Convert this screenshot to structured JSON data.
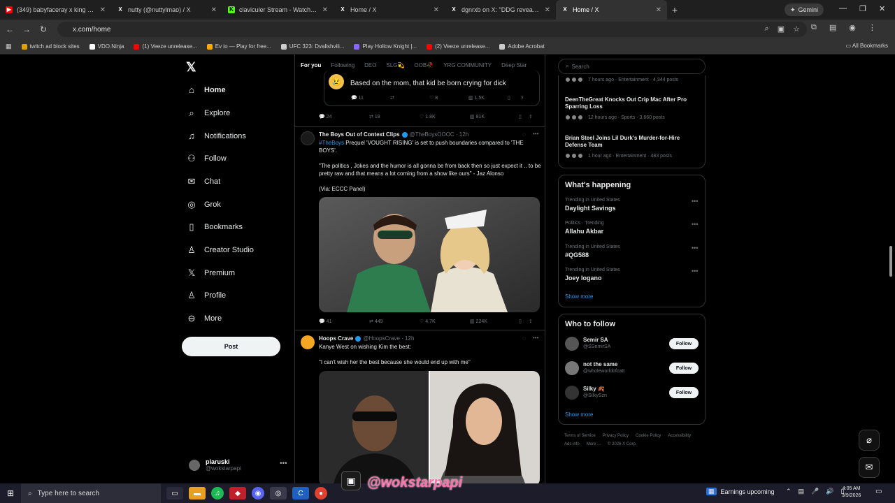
{
  "browser": {
    "tabs": [
      {
        "title": "(349) babyfaceray x king hendr",
        "fav_color": "#ff0000",
        "fav": "▶"
      },
      {
        "title": "nutty (@nuttylmao) / X",
        "fav_color": "#000000",
        "fav": "X"
      },
      {
        "title": "claviculer Stream - Watch Live o",
        "fav_color": "#53fc18",
        "fav": "K"
      },
      {
        "title": "Home / X",
        "fav_color": "#000000",
        "fav": "X"
      },
      {
        "title": "dgnrxb on X: \"DDG revealed th",
        "fav_color": "#000000",
        "fav": "X"
      },
      {
        "title": "Home / X",
        "fav_color": "#000000",
        "fav": "X"
      }
    ],
    "gemini_label": "Gemini",
    "url": "x.com/home",
    "bookmarks": [
      {
        "label": "twitch ad block sites",
        "color": "#e0a000"
      },
      {
        "label": "VDO.Ninja",
        "color": "#ffffff"
      },
      {
        "label": "(1) Veeze unrelease...",
        "color": "#ff0000"
      },
      {
        "label": "Ev io — Play for free...",
        "color": "#ffaa00"
      },
      {
        "label": "UFC 323: Dvalishvili...",
        "color": "#cccccc"
      },
      {
        "label": "Play Hollow Knight |...",
        "color": "#8866ff"
      },
      {
        "label": "(2) Veeze unrelease...",
        "color": "#ff0000"
      },
      {
        "label": "Adobe Acrobat",
        "color": "#cccccc"
      }
    ],
    "all_bookmarks": "All Bookmarks"
  },
  "nav": {
    "items": [
      {
        "label": "Home",
        "icon": "home-icon",
        "glyph": "⌂"
      },
      {
        "label": "Explore",
        "icon": "search-icon",
        "glyph": "⌕"
      },
      {
        "label": "Notifications",
        "icon": "bell-icon",
        "glyph": "🔔"
      },
      {
        "label": "Follow",
        "icon": "follow-icon",
        "glyph": "👤"
      },
      {
        "label": "Chat",
        "icon": "mail-icon",
        "glyph": "✉"
      },
      {
        "label": "Grok",
        "icon": "grok-icon",
        "glyph": "◎"
      },
      {
        "label": "Bookmarks",
        "icon": "bookmark-icon",
        "glyph": "🔖"
      },
      {
        "label": "Creator Studio",
        "icon": "creator-icon",
        "glyph": "♙"
      },
      {
        "label": "Premium",
        "icon": "x-premium-icon",
        "glyph": "𝕏"
      },
      {
        "label": "Profile",
        "icon": "profile-icon",
        "glyph": "👤"
      },
      {
        "label": "More",
        "icon": "more-icon",
        "glyph": "⊖"
      }
    ],
    "post_label": "Post",
    "account": {
      "name": "plaruski",
      "handle": "@wokstarpapi"
    }
  },
  "feed": {
    "tabs": [
      "For you",
      "Following",
      "DEO",
      "SLG💫",
      "OOB🥀",
      "YRG COMMUNITY",
      "Deep Star"
    ],
    "quoted_text": "Based on the mom, that kid be born crying for dick",
    "quoted_actions": [
      "11",
      "",
      "8",
      "1.5K",
      ""
    ],
    "prev_actions": [
      "24",
      "18",
      "1.8K",
      "81K",
      ""
    ],
    "tweet1": {
      "name": "The Boys Out of Context Clips",
      "handle": "@TheBoysOOOC · 12h",
      "hashtag": "#TheBoys",
      "line1": " Prequel 'VOUGHT RISING' is set to push boundaries compared to 'THE BOYS'.",
      "quote": "\"The politics , Jokes and the humor is all gonna be from back then so just expect it .. to be pretty raw and that means a lot coming from a show like ours\" - Jaz Alonso",
      "via": "(Via: ECCC Panel)",
      "actions": [
        "41",
        "449",
        "4.7K",
        "224K",
        ""
      ]
    },
    "tweet2": {
      "name": "Hoops Crave",
      "handle": "@HoopsCrave · 12h",
      "line1": "Kanye West on wishing Kim the best:",
      "quote": "\"I can't wish her the best because she would end up with me\""
    }
  },
  "right": {
    "search_placeholder": "Search",
    "news": [
      {
        "title": "",
        "meta": "7 hours ago · Entertainment · 4,344 posts"
      },
      {
        "title": "DeenTheGreat Knocks Out Crip Mac After Pro Sparring Loss",
        "meta": "12 hours ago · Sports · 3,660 posts"
      },
      {
        "title": "Brian Steel Joins Lil Durk's Murder-for-Hire Defense Team",
        "meta": "1 hour ago · Entertainment · 483 posts"
      }
    ],
    "happening_title": "What's happening",
    "trends": [
      {
        "context": "Trending in United States",
        "name": "Daylight Savings"
      },
      {
        "context": "Politics · Trending",
        "name": "Allahu Akbar"
      },
      {
        "context": "Trending in United States",
        "name": "#QG588"
      },
      {
        "context": "Trending in United States",
        "name": "Joey logano"
      }
    ],
    "show_more": "Show more",
    "wtf_title": "Who to follow",
    "follows": [
      {
        "name": "Semir SA",
        "handle": "@SSemirSA"
      },
      {
        "name": "not the same",
        "handle": "@wholeworldofcatt"
      },
      {
        "name": "Silky 🍂",
        "handle": "@SilkySzn"
      }
    ],
    "follow_label": "Follow",
    "footer": [
      "Terms of Service",
      "Privacy Policy",
      "Cookie Policy",
      "Accessibility",
      "Ads info",
      "More ...",
      "© 2026 X Corp."
    ]
  },
  "taskbar": {
    "search_placeholder": "Type here to search",
    "stream_name": "@wokstarpapi",
    "earnings": "Earnings upcoming",
    "time": "4:05 AM",
    "date": "3/9/2026"
  }
}
